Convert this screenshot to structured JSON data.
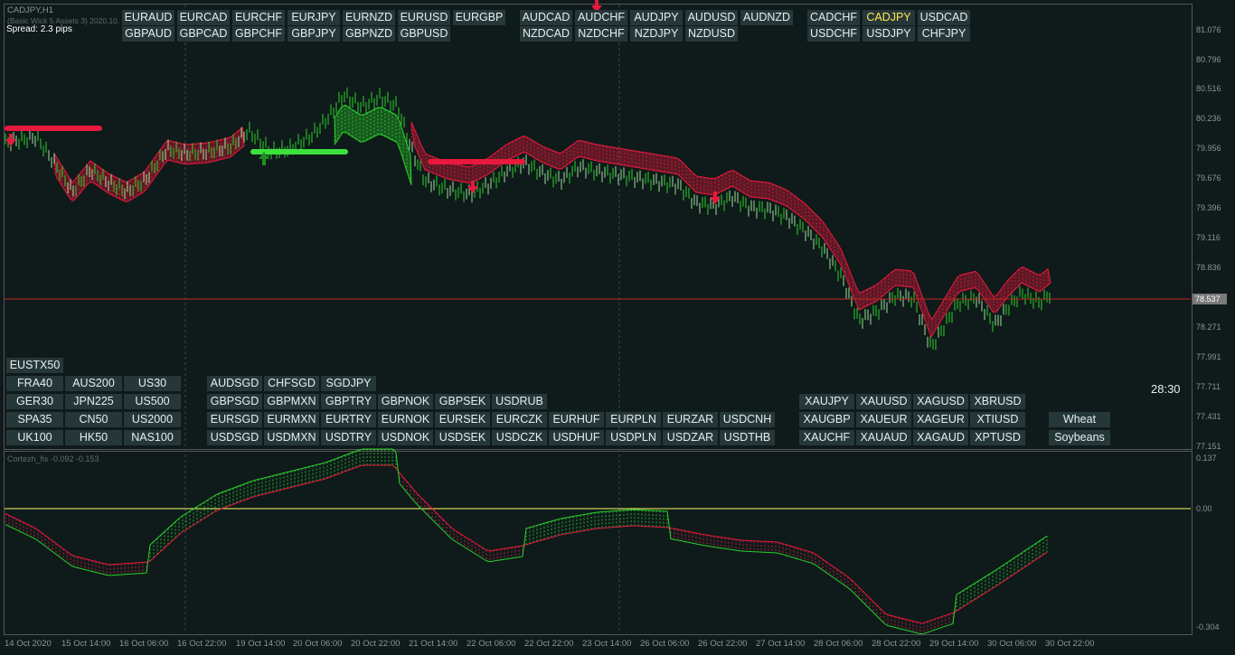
{
  "chart": {
    "title": "CADJPY,H1",
    "subtitle": "(Basic Wick 5 Assets 3) 2020.10.",
    "spread": "Spread: 2.3 pips",
    "countdown": "28:30",
    "current_price": "78.537",
    "colors": {
      "bull": "#2bd12b",
      "bear": "#e8193c",
      "zero_line": "#ffff66",
      "price_line": "#c0281e"
    }
  },
  "indicator": {
    "title": "Cortezh_fix -0.092 -0.153"
  },
  "price_axis": [
    "81.076",
    "80.796",
    "80.516",
    "80.236",
    "79.956",
    "79.676",
    "79.396",
    "79.116",
    "78.836",
    "78.271",
    "77.991",
    "77.711",
    "77.431",
    "77.151"
  ],
  "indicator_axis": [
    "0.137",
    "0.00",
    "-0.304"
  ],
  "time_axis": [
    "14 Oct 2020",
    "15 Oct 14:00",
    "16 Oct 06:00",
    "16 Oct 22:00",
    "19 Oct 14:00",
    "20 Oct 06:00",
    "20 Oct 22:00",
    "21 Oct 14:00",
    "22 Oct 06:00",
    "22 Oct 22:00",
    "23 Oct 14:00",
    "26 Oct 06:00",
    "26 Oct 22:00",
    "27 Oct 14:00",
    "28 Oct 06:00",
    "28 Oct 22:00",
    "29 Oct 14:00",
    "30 Oct 06:00",
    "30 Oct 22:00"
  ],
  "symbol_rows_top": [
    [
      "EURAUD",
      "EURCAD",
      "EURCHF",
      "EURJPY",
      "EURNZD",
      "EURUSD",
      "EURGBP"
    ],
    [
      "GBPAUD",
      "GBPCAD",
      "GBPCHF",
      "GBPJPY",
      "GBPNZD",
      "GBPUSD"
    ],
    [
      "AUDCAD",
      "AUDCHF",
      "AUDJPY",
      "AUDUSD",
      "AUDNZD"
    ],
    [
      "NZDCAD",
      "NZDCHF",
      "NZDJPY",
      "NZDUSD"
    ],
    [
      "CADCHF",
      "CADJPY",
      "USDCAD"
    ],
    [
      "USDCHF",
      "USDJPY",
      "CHFJPY"
    ]
  ],
  "symbol_rows_bottom": [
    [
      "EUSTX50"
    ],
    [
      "FRA40",
      "AUS200",
      "US30"
    ],
    [
      "GER30",
      "JPN225",
      "US500"
    ],
    [
      "SPA35",
      "CN50",
      "US2000"
    ],
    [
      "UK100",
      "HK50",
      "NAS100"
    ],
    [
      "AUDSGD",
      "CHFSGD",
      "SGDJPY"
    ],
    [
      "GBPSGD",
      "GBPMXN",
      "GBPTRY",
      "GBPNOK",
      "GBPSEK",
      "USDRUB"
    ],
    [
      "EURSGD",
      "EURMXN",
      "EURTRY",
      "EURNOK",
      "EURSEK",
      "EURCZK",
      "EURHUF",
      "EURPLN",
      "EURZAR",
      "USDCNH"
    ],
    [
      "USDSGD",
      "USDMXN",
      "USDTRY",
      "USDNOK",
      "USDSEK",
      "USDCZK",
      "USDHUF",
      "USDPLN",
      "USDZAR",
      "USDTHB"
    ],
    [
      "XAUJPY",
      "XAUUSD",
      "XAGUSD",
      "XBRUSD"
    ],
    [
      "XAUGBP",
      "XAUEUR",
      "XAGEUR",
      "XTIUSD"
    ],
    [
      "XAUCHF",
      "XAUAUD",
      "XAGAUD",
      "XPTUSD"
    ],
    [
      "Wheat"
    ],
    [
      "Soybeans"
    ]
  ],
  "active_symbol": "CADJPY"
}
